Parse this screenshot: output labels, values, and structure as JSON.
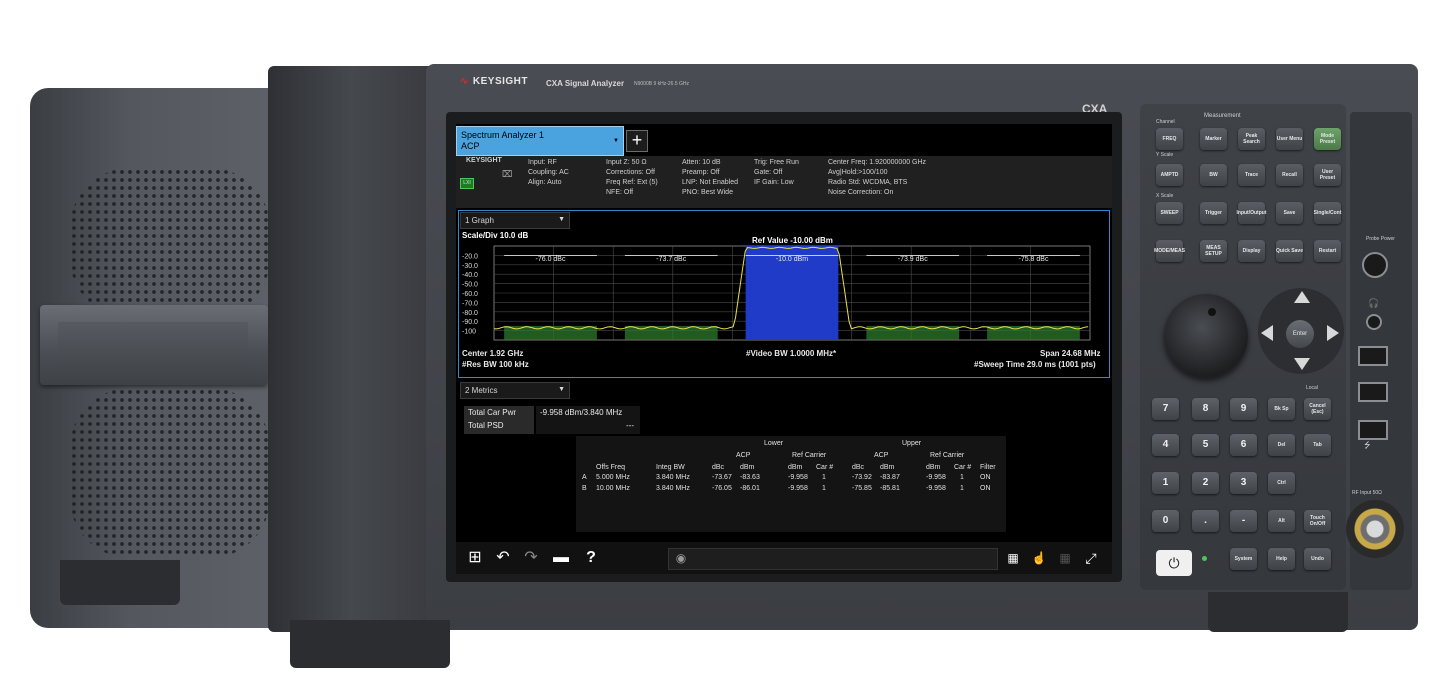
{
  "brand": {
    "logo": "KEYSIGHT",
    "model": "CXA Signal Analyzer",
    "model_sub": "N9000B 9 kHz-26.5 GHz",
    "series": "CXA"
  },
  "screen": {
    "tab_title": "Spectrum Analyzer 1",
    "tab_sub": "ACP",
    "add_tab": "+",
    "info": {
      "logo": "KEYSIGHT",
      "lxi": "LXI",
      "col1": [
        "Input: RF",
        "Coupling: AC",
        "Align: Auto"
      ],
      "col2": [
        "Input Z: 50 Ω",
        "Corrections: Off",
        "Freq Ref: Ext (5)",
        "NFE: Off"
      ],
      "col3": [
        "Atten: 10 dB",
        "Preamp: Off",
        "LNP: Not Enabled",
        "PNO: Best Wide"
      ],
      "col4": [
        "Trig: Free Run",
        "Gate: Off",
        "IF Gain: Low"
      ],
      "col5": [
        "Center Freq: 1.920000000 GHz",
        "Avg|Hold:>100/100",
        "Radio Std: WCDMA, BTS",
        "Noise Correction: On"
      ]
    },
    "graph": {
      "selector": "1 Graph",
      "scale": "Scale/Div 10.0 dB",
      "ref_value": "Ref Value -10.00 dBm",
      "center": "Center 1.92 GHz",
      "res_bw": "#Res BW 100 kHz",
      "video_bw": "#Video BW 1.0000 MHz*",
      "span": "Span 24.68 MHz",
      "sweep": "#Sweep Time 29.0 ms (1001 pts)"
    },
    "metrics": {
      "selector": "2 Metrics",
      "rows": [
        {
          "label": "Total Car Pwr",
          "value": "-9.958 dBm/3.840 MHz"
        },
        {
          "label": "Total PSD",
          "value": "---"
        }
      ]
    },
    "acp": {
      "group_lower": "Lower",
      "group_upper": "Upper",
      "sub_acp": "ACP",
      "sub_ref": "Ref Carrier",
      "headers": [
        "Offs Freq",
        "Integ BW",
        "dBc",
        "dBm",
        "dBm",
        "Car #",
        "dBc",
        "dBm",
        "dBm",
        "Car #",
        "Filter"
      ],
      "rows": [
        [
          "A",
          "5.000 MHz",
          "3.840 MHz",
          "-73.67",
          "-83.63",
          "-9.958",
          "1",
          "-73.92",
          "-83.87",
          "-9.958",
          "1",
          "ON"
        ],
        [
          "B",
          "10.00 MHz",
          "3.840 MHz",
          "-76.05",
          "-86.01",
          "-9.958",
          "1",
          "-75.85",
          "-85.81",
          "-9.958",
          "1",
          "ON"
        ]
      ]
    }
  },
  "chart_data": {
    "type": "bar",
    "title": "",
    "xlabel": "",
    "ylabel": "",
    "y_ticks": [
      "-20.0",
      "-30.0",
      "-40.0",
      "-50.0",
      "-60.0",
      "-70.0",
      "-80.0",
      "-90.0",
      "-100"
    ],
    "ylim": [
      -110,
      -10
    ],
    "x_range_mhz": [
      -12.34,
      12.34
    ],
    "channels": [
      {
        "label": "-76.0 dBc",
        "center_mhz": -10,
        "bw_mhz": 3.84,
        "value_dbm": -86.01
      },
      {
        "label": "-73.7 dBc",
        "center_mhz": -5,
        "bw_mhz": 3.84,
        "value_dbm": -83.63
      },
      {
        "label": "-10.0 dBm",
        "center_mhz": 0,
        "bw_mhz": 3.84,
        "value_dbm": -9.958
      },
      {
        "label": "-73.9 dBc",
        "center_mhz": 5,
        "bw_mhz": 3.84,
        "value_dbm": -83.87
      },
      {
        "label": "-75.8 dBc",
        "center_mhz": 10,
        "bw_mhz": 3.84,
        "value_dbm": -85.81
      }
    ],
    "grid": true
  },
  "keypad": {
    "section_title": "Measurement",
    "label_channel": "Channel",
    "label_yscale": "Y Scale",
    "label_xscale": "X Scale",
    "label_local": "Local",
    "keys": [
      "FREQ",
      "Marker",
      "Peak Search",
      "User Menu",
      "Mode Preset",
      "AMPTD",
      "BW",
      "Trace",
      "Recall",
      "User Preset",
      "SWEEP",
      "Trigger",
      "Input/Output",
      "Save",
      "Single/Cont",
      "MODE/MEAS",
      "MEAS SETUP",
      "Display",
      "Quick Save",
      "Restart"
    ],
    "numbers": [
      "7",
      "8",
      "9",
      "4",
      "5",
      "6",
      "1",
      "2",
      "3",
      "0",
      ".",
      "-"
    ],
    "side_keys": [
      "Bk Sp",
      "Cancel (Esc)",
      "Del",
      "Tab",
      "Ctrl",
      "Alt",
      "Touch On/Off",
      "System",
      "Help",
      "Undo"
    ],
    "enter": "Enter",
    "power_icon": "power-icon",
    "probe_label": "Probe Power",
    "rf_label": "RF Input 50Ω"
  },
  "colors": {
    "tab": "#4aa3df",
    "carrier": "#1f3bc8",
    "adjacent": "#2d7a2d",
    "trace": "#e9e04a",
    "grid": "#4a4a4a"
  }
}
